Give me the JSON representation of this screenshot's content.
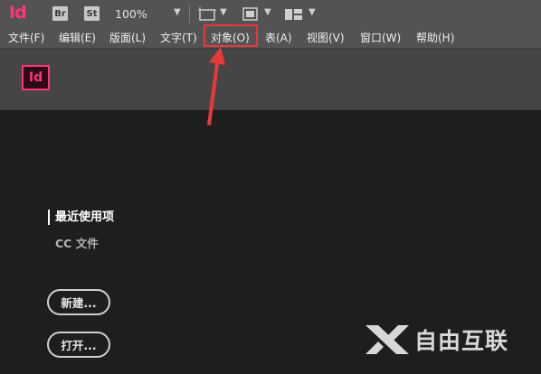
{
  "toolbar": {
    "logo": "Id",
    "bridge_label": "Br",
    "stock_label": "St",
    "zoom": "100%"
  },
  "menu": {
    "items": [
      {
        "label": "文件(F)"
      },
      {
        "label": "编辑(E)"
      },
      {
        "label": "版面(L)"
      },
      {
        "label": "文字(T)"
      },
      {
        "label": "对象(O)"
      },
      {
        "label": "表(A)"
      },
      {
        "label": "视图(V)"
      },
      {
        "label": "窗口(W)"
      },
      {
        "label": "帮助(H)"
      }
    ],
    "highlighted_index": 4
  },
  "start": {
    "logo": "Id",
    "recent_label": "最近使用项",
    "cc_files_label": "CC 文件",
    "new_button": "新建...",
    "open_button": "打开..."
  },
  "watermark": {
    "text": "自由互联"
  },
  "colors": {
    "accent": "#ff3377",
    "annotation": "#e8393a",
    "toolbar_bg": "#535353",
    "header_bg": "#454545",
    "main_bg": "#1e1e1e"
  }
}
